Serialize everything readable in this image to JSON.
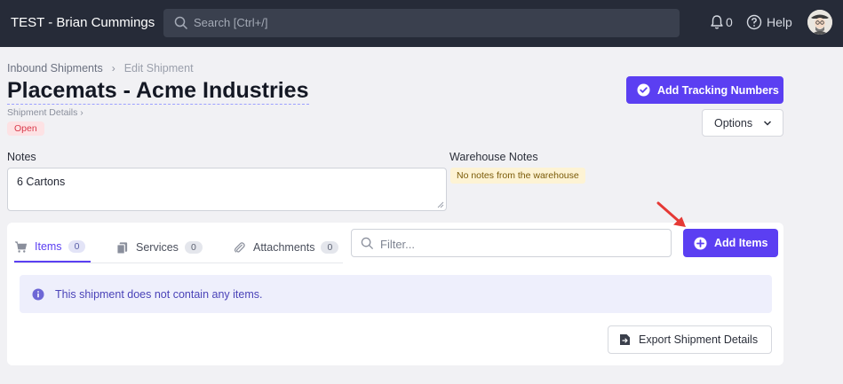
{
  "app": {
    "title": "TEST - Brian Cummings"
  },
  "topbar": {
    "search_placeholder": "Search [Ctrl+/]",
    "notifications_count": "0",
    "help_label": "Help"
  },
  "breadcrumb": {
    "parent": "Inbound Shipments",
    "current": "Edit Shipment"
  },
  "page": {
    "title": "Placemats - Acme Industries",
    "sub_breadcrumb": "Shipment Details",
    "status": "Open"
  },
  "actions": {
    "add_tracking_label": "Add Tracking Numbers",
    "options_label": "Options",
    "add_items_label": "Add Items",
    "export_label": "Export Shipment Details"
  },
  "notes": {
    "label": "Notes",
    "value": "6 Cartons",
    "warehouse_label": "Warehouse Notes",
    "warehouse_value": "No notes from the warehouse"
  },
  "tabs": [
    {
      "label": "Items",
      "count": "0",
      "icon": "cart-icon"
    },
    {
      "label": "Services",
      "count": "0",
      "icon": "documents-icon"
    },
    {
      "label": "Attachments",
      "count": "0",
      "icon": "paperclip-icon"
    }
  ],
  "filter": {
    "placeholder": "Filter..."
  },
  "alert": {
    "message": "This shipment does not contain any items."
  },
  "colors": {
    "topbar_bg": "#262b38",
    "accent": "#5b3ff2",
    "open_badge_bg": "#fde2e4",
    "open_badge_text": "#d93a4b",
    "annotation_arrow": "#e53935"
  }
}
